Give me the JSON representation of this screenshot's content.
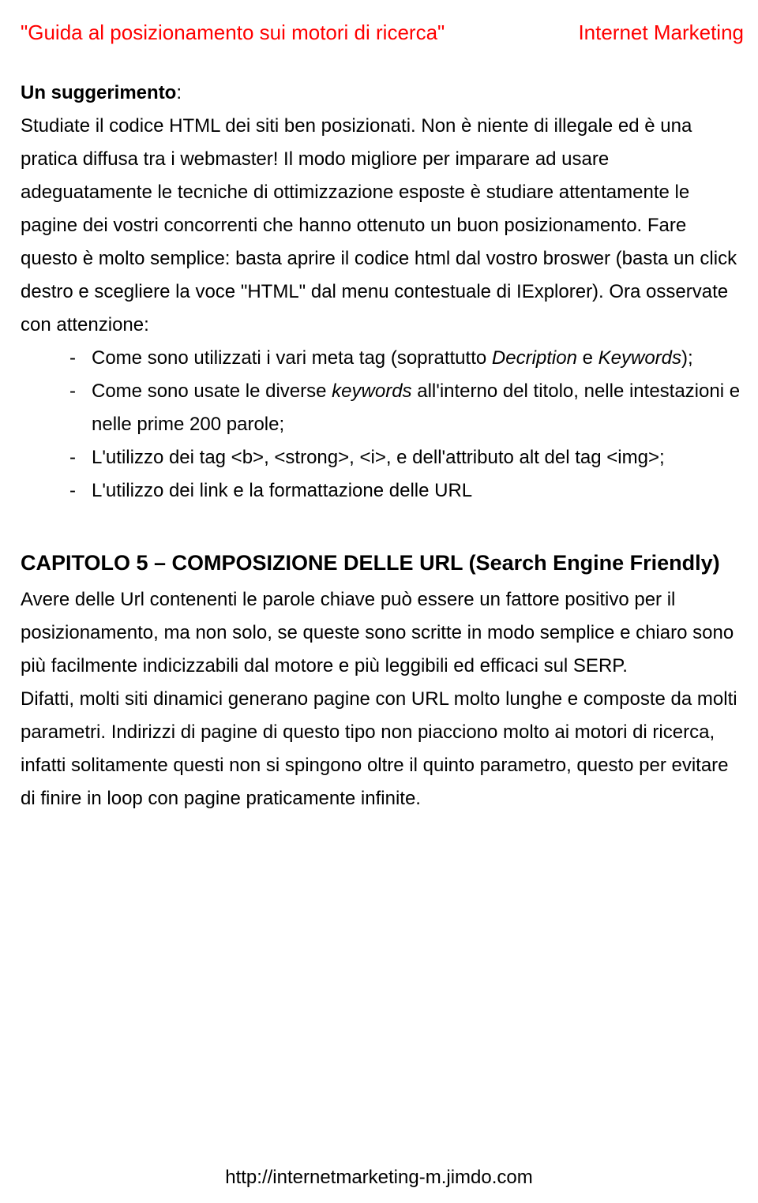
{
  "header": {
    "left": "\"Guida al posizionamento sui motori di ricerca\"",
    "right": "Internet Marketing"
  },
  "section1": {
    "subhead": "Un suggerimento",
    "p1a": "Studiate il codice HTML dei siti ben posizionati. Non è niente di illegale ed è una pratica diffusa tra i webmaster! Il modo migliore per imparare ad usare adeguatamente le tecniche di ottimizzazione esposte è studiare attentamente le pagine dei vostri concorrenti che hanno ottenuto un buon posizionamento. Fare questo è molto semplice: basta aprire il codice html dal vostro broswer (basta un click destro e scegliere la voce \"HTML\" dal menu contestuale di IExplorer). Ora osservate con attenzione:",
    "bullets": {
      "b1_pre": "Come sono utilizzati i vari meta tag (soprattutto ",
      "b1_em1": "Decription",
      "b1_mid": " e ",
      "b1_em2": "Keywords",
      "b1_post": ");",
      "b2_pre": "Come sono usate le diverse ",
      "b2_em": "keywords ",
      "b2_post": "all'interno del titolo, nelle intestazioni e nelle prime 200 parole;",
      "b3": "L'utilizzo dei tag <b>, <strong>, <i>, e dell'attributo alt del tag <img>;",
      "b4": "L'utilizzo dei link e la formattazione delle URL"
    }
  },
  "chapter": {
    "title": "CAPITOLO 5 – COMPOSIZIONE DELLE URL (Search Engine Friendly)",
    "p1": "Avere delle Url contenenti le parole chiave può essere un fattore positivo per il posizionamento, ma non solo, se queste sono scritte in modo semplice e chiaro sono più facilmente indicizzabili dal motore e più leggibili ed efficaci sul SERP.",
    "p2": "Difatti, molti siti dinamici generano pagine con URL molto lunghe e composte da molti parametri. Indirizzi di pagine di questo tipo non piacciono molto ai motori di ricerca, infatti solitamente questi non si spingono oltre il quinto parametro, questo per evitare di finire in loop con pagine praticamente infinite."
  },
  "footer": {
    "url": "http://internetmarketing-m.jimdo.com"
  }
}
